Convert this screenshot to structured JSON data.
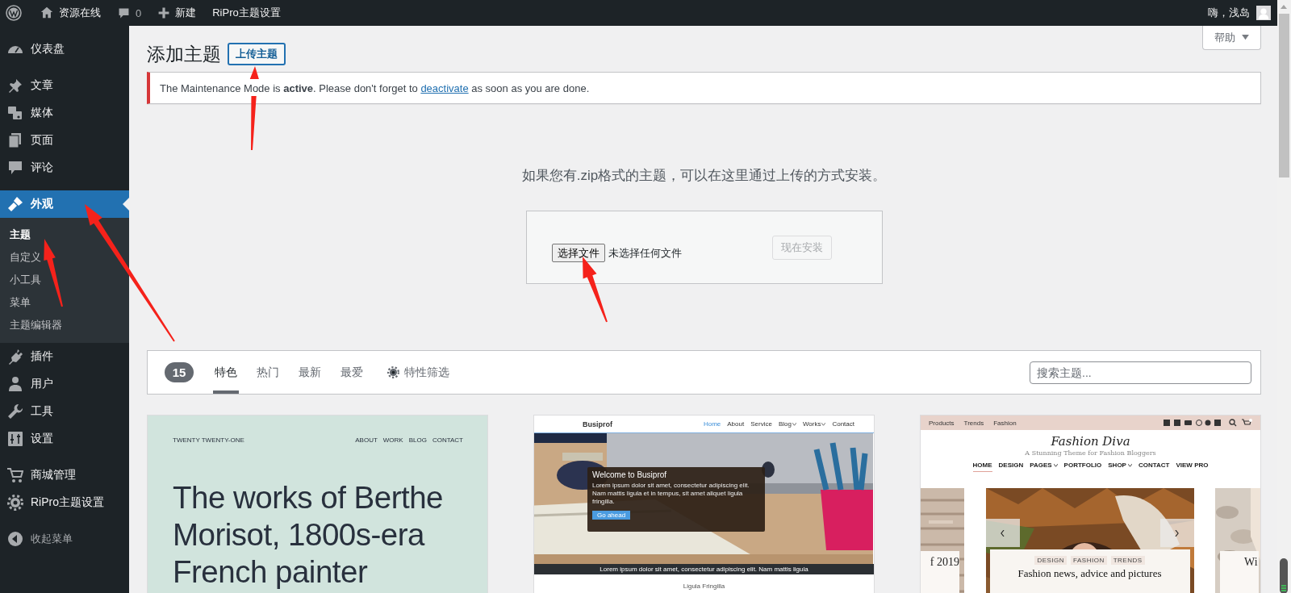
{
  "admin_bar": {
    "items": [
      {
        "kind": "logo"
      },
      {
        "kind": "home",
        "label": "资源在线"
      },
      {
        "kind": "comments",
        "label": "0"
      },
      {
        "kind": "new",
        "label": "新建"
      },
      {
        "kind": "text",
        "label": "RiPro主题设置"
      }
    ],
    "account": "嗨，浅岛"
  },
  "sidebar": {
    "groups": [
      [
        {
          "label": "仪表盘",
          "selected": false
        }
      ],
      [
        {
          "label": "文章",
          "selected": false
        },
        {
          "label": "媒体",
          "selected": false
        },
        {
          "label": "页面",
          "selected": false
        },
        {
          "label": "评论",
          "selected": false
        }
      ],
      [
        {
          "label": "外观",
          "selected": true,
          "children": [
            {
              "label": "主题",
              "selected": true
            },
            {
              "label": "自定义",
              "selected": false
            },
            {
              "label": "小工具",
              "selected": false
            },
            {
              "label": "菜单",
              "selected": false
            },
            {
              "label": "主题编辑器",
              "selected": false
            }
          ]
        },
        {
          "label": "插件",
          "selected": false
        },
        {
          "label": "用户",
          "selected": false
        },
        {
          "label": "工具",
          "selected": false
        },
        {
          "label": "设置",
          "selected": false
        }
      ],
      [
        {
          "label": "商城管理",
          "selected": false
        },
        {
          "label": "RiPro主题设置",
          "selected": false
        }
      ]
    ],
    "collapse": "收起菜单"
  },
  "help_button": "帮助",
  "heading": "添加主题",
  "upload_button": "上传主题",
  "notice": {
    "text": "The Maintenance Mode is **active**. Please don't forget to",
    "link": "deactivate",
    "after": "as soon as you are done."
  },
  "upload": {
    "hint": "如果您有.zip格式的主题，可以在这里通过上传的方式安装。",
    "choose_button": "选择文件",
    "file_status": "未选择任何文件",
    "install_button": {
      "label": "现在安装",
      "disabled": true
    }
  },
  "filter_bar": {
    "count": "15",
    "tabs": [
      {
        "label": "特色",
        "selected": true
      },
      {
        "label": "热门",
        "selected": false
      },
      {
        "label": "最新",
        "selected": false
      },
      {
        "label": "最爱",
        "selected": false
      }
    ],
    "feature_filter": "特性筛选",
    "search": {
      "placeholder": "搜索主题..."
    }
  },
  "themes": [
    {
      "kind": "twentyone",
      "site_title": "TWENTY TWENTY-ONE",
      "nav": [
        "ABOUT",
        "WORK",
        "BLOG",
        "CONTACT"
      ],
      "headline": "The works of Berthe Morisot, 1800s-era French painter"
    },
    {
      "kind": "busiprof",
      "logo": "Busiprof",
      "nav": [
        {
          "label": "Home",
          "selected": true,
          "dropdown": false
        },
        {
          "label": "About",
          "selected": false,
          "dropdown": false
        },
        {
          "label": "Service",
          "selected": false,
          "dropdown": false
        },
        {
          "label": "Blog",
          "selected": false,
          "dropdown": true
        },
        {
          "label": "Works",
          "selected": false,
          "dropdown": true
        },
        {
          "label": "Contact",
          "selected": false,
          "dropdown": false
        }
      ],
      "hero_title": "Welcome to Busiprof",
      "hero_text": "Lorem ipsum dolor sit amet, consectetur adipiscing elit. Nam mattis ligula et in tempus, sit amet aliquet ligula fringilla.",
      "hero_button": "Go ahead",
      "strip": "Lorem ipsum dolor sit amet, consectetur adipiscing elit. Nam mattis ligula",
      "section_title": "Ligula Fringilla"
    },
    {
      "kind": "fashiondiva",
      "top_links": [
        "Products",
        "Trends",
        "Fashion"
      ],
      "logo": "Fashion Diva",
      "tagline": "A Stunning Theme for Fashion Bloggers",
      "nav": [
        {
          "label": "HOME",
          "selected": true,
          "dropdown": false
        },
        {
          "label": "DESIGN",
          "selected": false,
          "dropdown": false
        },
        {
          "label": "PAGES",
          "selected": false,
          "dropdown": true
        },
        {
          "label": "PORTFOLIO",
          "selected": false,
          "dropdown": false
        },
        {
          "label": "SHOP",
          "selected": false,
          "dropdown": true
        },
        {
          "label": "CONTACT",
          "selected": false,
          "dropdown": false
        },
        {
          "label": "VIEW PRO",
          "selected": false,
          "dropdown": false
        }
      ],
      "left_caption": "f 2019",
      "tags": [
        "DESIGN",
        "FASHION",
        "TRENDS"
      ],
      "slide_title": "Fashion news, advice and pictures",
      "right_caption": "Wi"
    }
  ]
}
